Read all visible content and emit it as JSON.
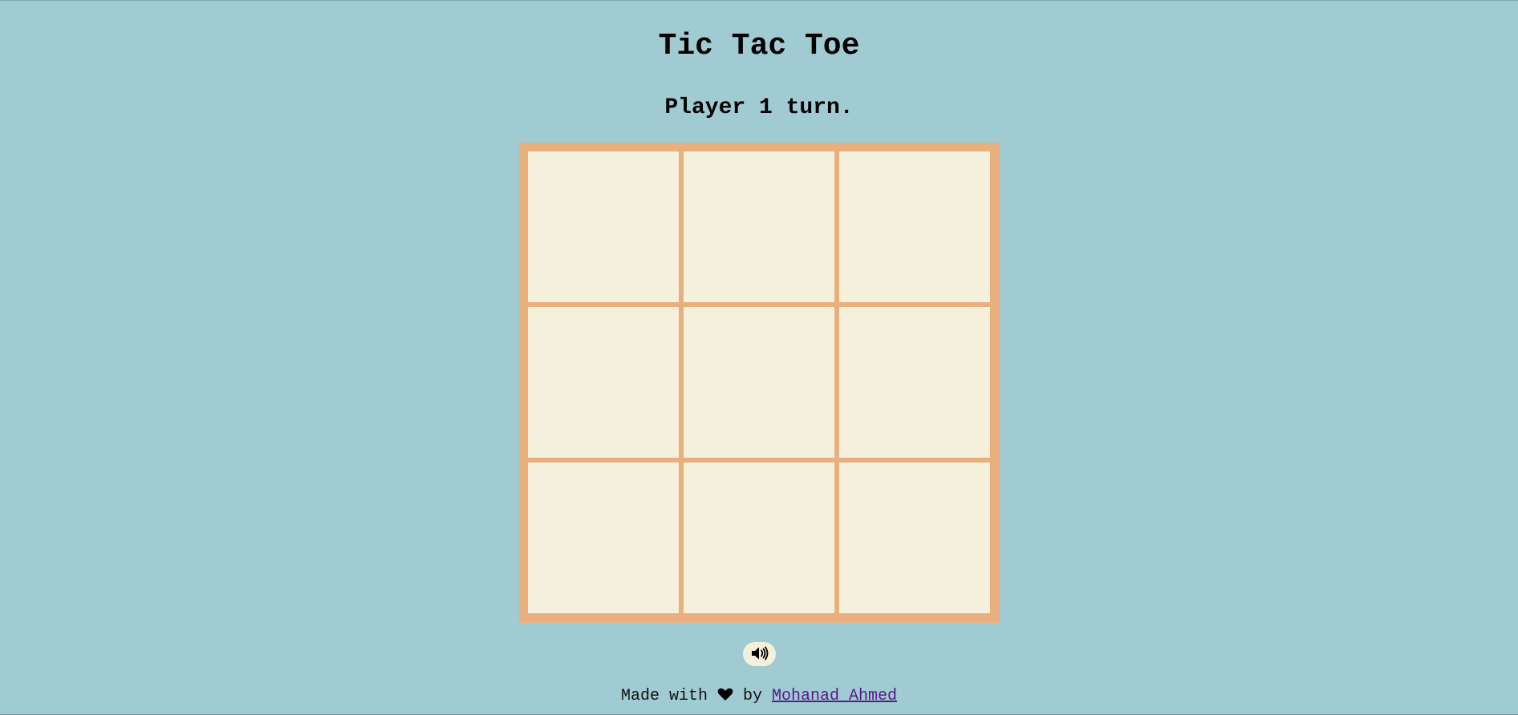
{
  "app": {
    "title": "Tic Tac Toe",
    "status": "Player 1 turn."
  },
  "board": {
    "cells": [
      "",
      "",
      "",
      "",
      "",
      "",
      "",
      "",
      ""
    ]
  },
  "sound": {
    "icon": "speaker-volume-icon"
  },
  "footer": {
    "made_with": "Made with",
    "heart_icon": "heart-icon",
    "by": "by",
    "author": "Mohanad Ahmed"
  },
  "colors": {
    "background": "#a1cbd2",
    "board_frame": "#e8b07e",
    "cell": "#f5f0dc",
    "link": "#551a8b"
  }
}
